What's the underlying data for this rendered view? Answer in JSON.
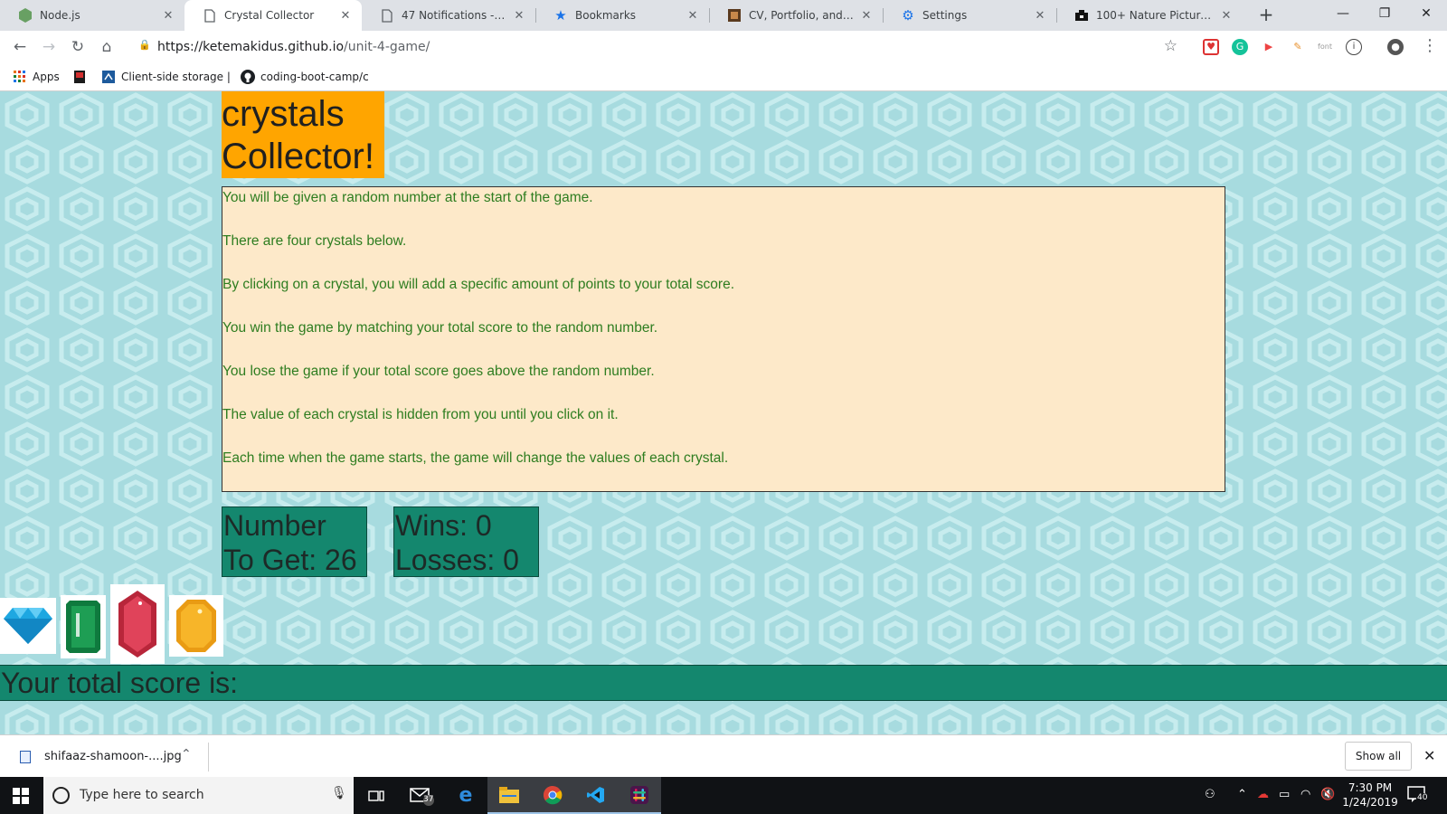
{
  "browser": {
    "tabs": [
      {
        "title": "Node.js",
        "icon": "nodejs-icon",
        "active": false
      },
      {
        "title": "Crystal Collector",
        "icon": "page-icon",
        "active": true
      },
      {
        "title": "47 Notifications - Wall | E",
        "icon": "page-icon",
        "active": false
      },
      {
        "title": "Bookmarks",
        "icon": "star-icon",
        "active": false
      },
      {
        "title": "CV, Portfolio, and Resum",
        "icon": "portfolio-icon",
        "active": false
      },
      {
        "title": "Settings",
        "icon": "gear-icon",
        "active": false
      },
      {
        "title": "100+ Nature Pictures | D",
        "icon": "camera-icon",
        "active": false
      }
    ],
    "url_host": "https://ketemakidus.github.io",
    "url_path": "/unit-4-game/",
    "bookmarks": [
      {
        "label": "Apps",
        "icon": "apps-grid-icon"
      },
      {
        "label": "",
        "icon": "bookmark-red-icon"
      },
      {
        "label": "Client-side storage | ",
        "icon": "mdn-icon"
      },
      {
        "label": "coding-boot-camp/c",
        "icon": "github-icon"
      }
    ]
  },
  "page": {
    "title_line1": "crystals",
    "title_line2": "Collector!",
    "instructions": [
      "You will be given a random number at the start of the game.",
      "There are four crystals below.",
      "By clicking on a crystal, you will add a specific amount of points to your total score.",
      "You win the game by matching your total score to the random number.",
      "You lose the game if your total score goes above the random number.",
      "The value of each crystal is hidden from you until you click on it.",
      "Each time when the game starts, the game will change the values of each crystal."
    ],
    "number_to_get_line1": "Number",
    "number_to_get_line2": "To Get: 26",
    "wins_text": "Wins: 0",
    "losses_text": "Losses: 0",
    "crystals": [
      {
        "name": "blue-diamond-crystal",
        "color": "#1ea7e1"
      },
      {
        "name": "green-emerald-crystal",
        "color": "#1e9e54"
      },
      {
        "name": "red-ruby-crystal",
        "color": "#d9364a"
      },
      {
        "name": "yellow-topaz-crystal",
        "color": "#f7b529"
      }
    ],
    "total_score_text": "Your total score is:"
  },
  "download_shelf": {
    "file_name": "shifaaz-shamoon-....jpg",
    "show_all": "Show all"
  },
  "taskbar": {
    "search_placeholder": "Type here to search",
    "mail_badge": "37",
    "time": "7:30 PM",
    "date": "1/24/2019",
    "notification_count": "40"
  },
  "colors": {
    "title_bg": "#ffa500",
    "instructions_bg": "#fde9c9",
    "instructions_text": "#2e7d20",
    "stat_bg": "#14876e",
    "page_bg": "#a7dbdf"
  }
}
